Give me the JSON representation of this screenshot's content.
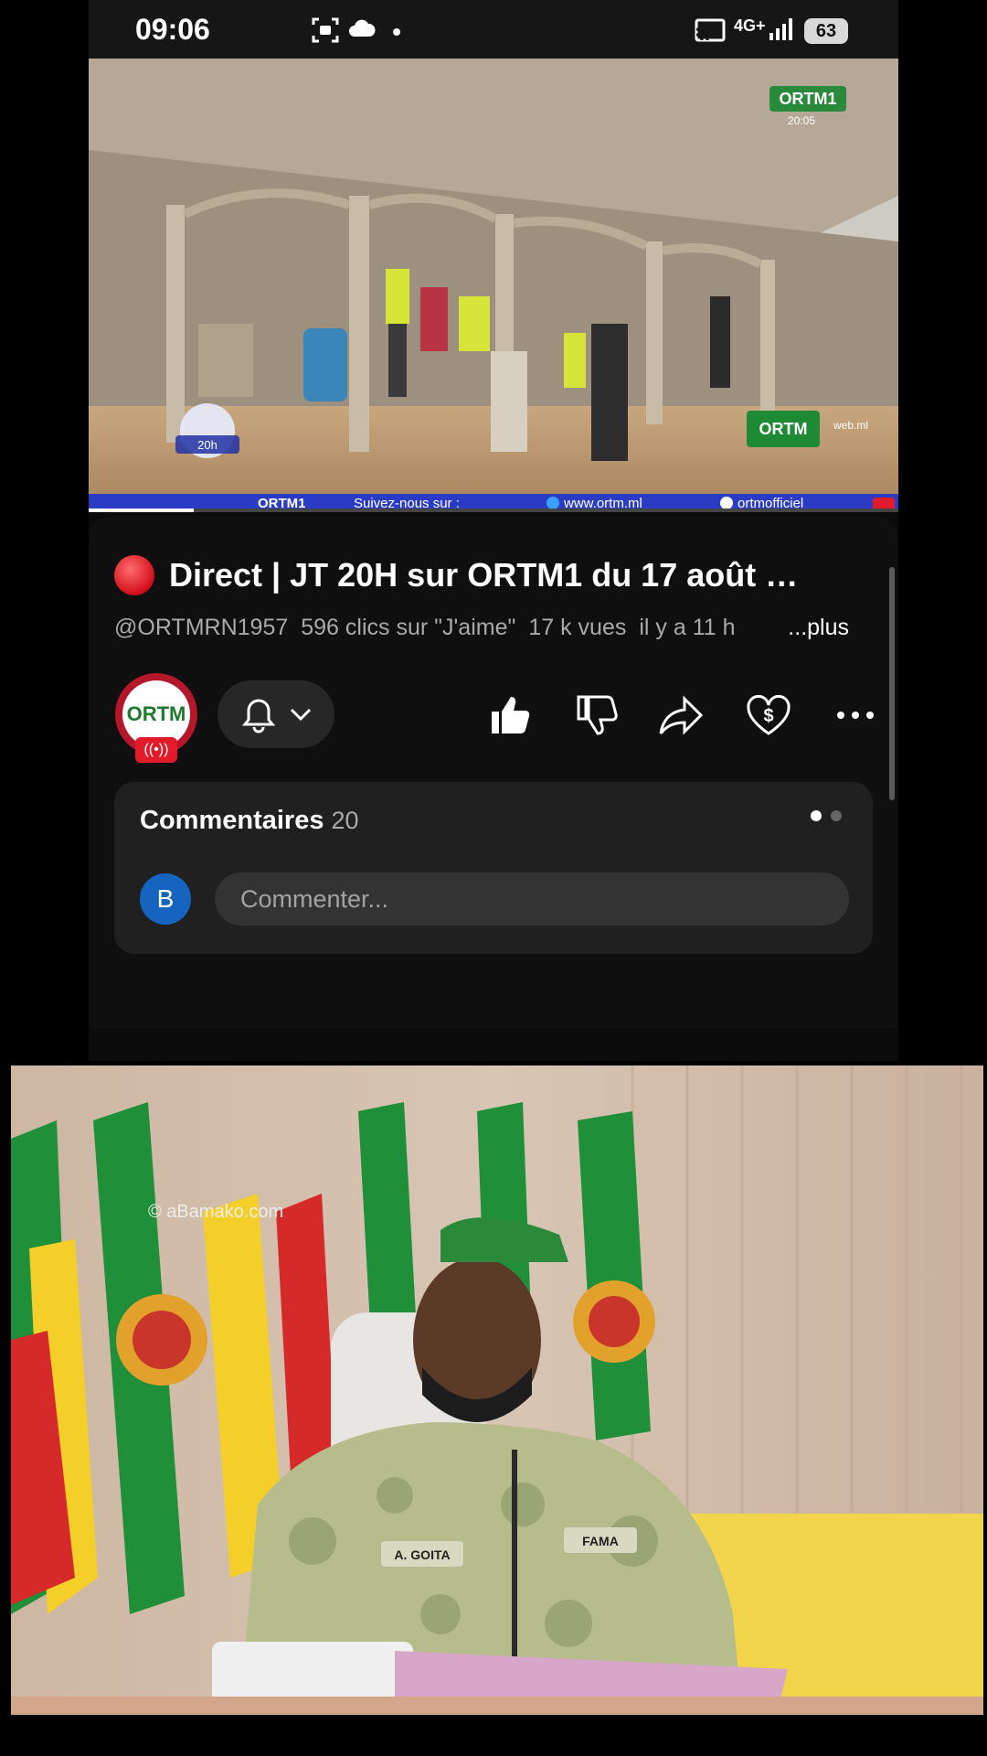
{
  "status_bar": {
    "time": "09:06",
    "network": "4G+",
    "battery": "63"
  },
  "video": {
    "overlay_logo": "ORTM1",
    "overlay_time": "20:05",
    "badge_text": "20h",
    "web_logo": "ORTM",
    "web_logo_suffix": "web.ml",
    "ticker": {
      "brand": "ORTM1",
      "follow": "Suivez-nous sur :",
      "website": "www.ortm.ml",
      "facebook": "ortmofficiel"
    },
    "progress": 0.13
  },
  "details": {
    "title": "Direct | JT 20H sur ORTM1 du 17 août …",
    "channel_handle": "@ORTMRN1957",
    "likes_text": "596 clics sur \"J'aime\"",
    "views_text": "17 k vues",
    "age_text": "il y a 11 h",
    "more_label": "...plus",
    "channel_logo": "ORTM",
    "live_icon": "broadcast-icon"
  },
  "actions": {
    "bell_icon": "bell-icon",
    "chevron_icon": "chevron-down-icon",
    "like_icon": "thumbs-up-icon",
    "dislike_icon": "thumbs-down-icon",
    "share_icon": "share-icon",
    "thanks_icon": "thanks-icon",
    "more_icon": "more-icon"
  },
  "comments": {
    "title": "Commentaires",
    "count": "20",
    "user_initial": "B",
    "placeholder": "Commenter..."
  },
  "photo": {
    "credit": "© aBamako.com",
    "name_tag_left": "A. GOITA",
    "name_tag_right": "FAMA"
  },
  "colors": {
    "accent_red": "#e11b2a",
    "avatar_blue": "#1565c0",
    "ticker_blue": "#2b3cc4"
  }
}
